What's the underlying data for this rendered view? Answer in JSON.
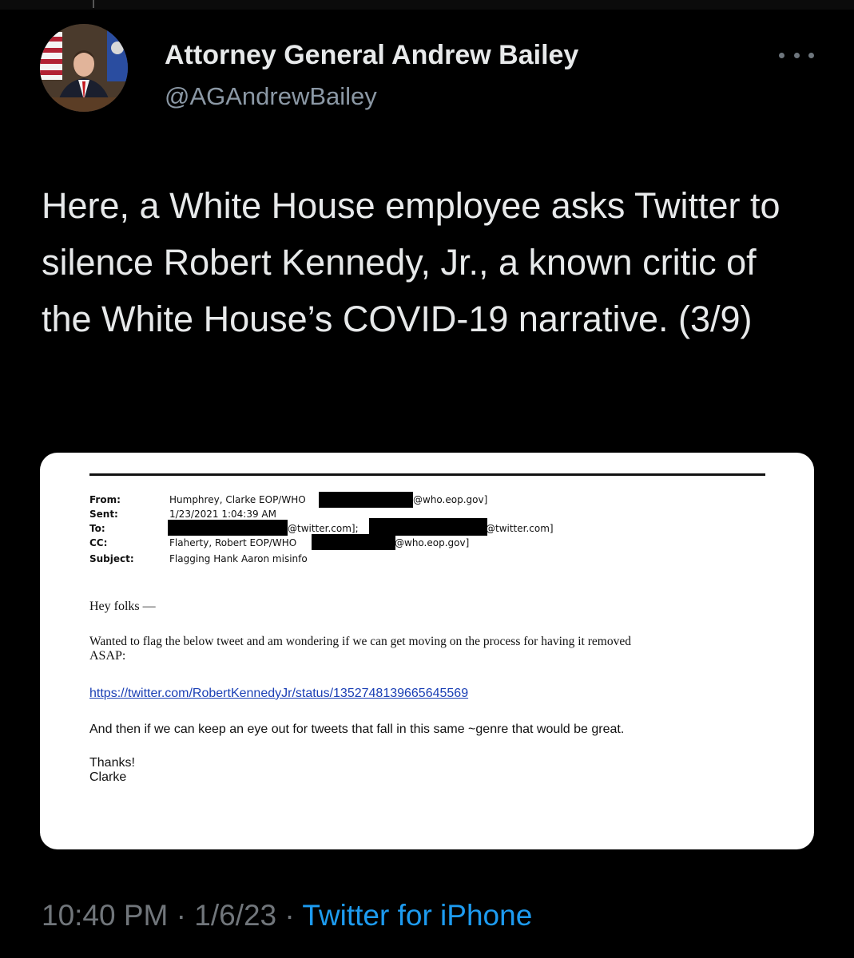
{
  "author": {
    "display_name": "Attorney General Andrew Bailey",
    "handle": "@AGAndrewBailey"
  },
  "tweet": {
    "text": "Here, a White House employee asks Twitter to silence Robert Kennedy, Jr., a known critic of the White House’s COVID-19 narrative. (3/9)"
  },
  "email": {
    "labels": {
      "from": "From:",
      "sent": "Sent:",
      "to": "To:",
      "cc": "CC:",
      "subject": "Subject:"
    },
    "from_name": "Humphrey, Clarke EOP/WHO",
    "from_domain": "@who.eop.gov]",
    "sent": "1/23/2021 1:04:39 AM",
    "to_domain_1": "@twitter.com];",
    "to_domain_2": "@twitter.com]",
    "cc_name": "Flaherty, Robert EOP/WHO",
    "cc_domain": "@who.eop.gov]",
    "subject": "Flagging Hank Aaron misinfo",
    "greeting": "Hey folks —",
    "body_line_1": "Wanted to flag the below tweet and am wondering if we can get moving on the process for having it removed",
    "body_line_2": "ASAP:",
    "link": "https://twitter.com/RobertKennedyJr/status/1352748139665645569",
    "followup": "And then if we can keep an eye out for tweets that fall in this same ~genre that would be great.",
    "signoff": "Thanks!",
    "signature": "Clarke"
  },
  "meta": {
    "time": "10:40 PM",
    "separator_1": " · ",
    "date": "1/6/23",
    "separator_2": " · ",
    "source": "Twitter for iPhone"
  },
  "colors": {
    "background": "#000000",
    "text": "#e7e9ea",
    "secondary": "#71767b",
    "link": "#1d9bf0"
  }
}
